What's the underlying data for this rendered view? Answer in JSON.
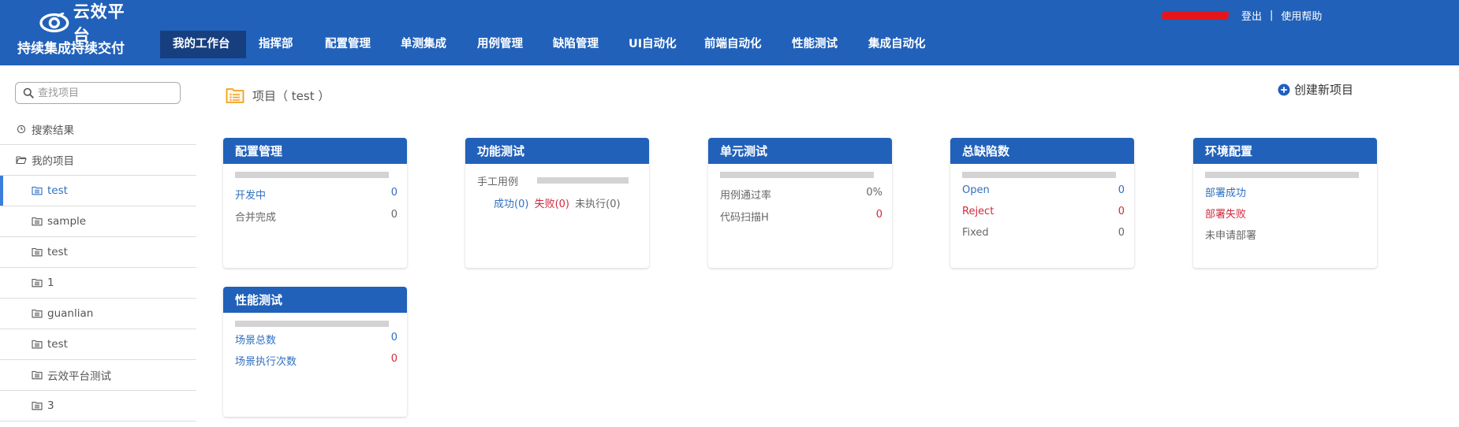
{
  "brand": {
    "name": "云效平台",
    "subtitle": "持续集成持续交付"
  },
  "nav": {
    "items": [
      {
        "label": "我的工作台",
        "active": true
      },
      {
        "label": "指挥部"
      },
      {
        "label": "配置管理"
      },
      {
        "label": "单测集成"
      },
      {
        "label": "用例管理"
      },
      {
        "label": "缺陷管理"
      },
      {
        "label": "UI自动化"
      },
      {
        "label": "前端自动化"
      },
      {
        "label": "性能测试"
      },
      {
        "label": "集成自动化"
      }
    ]
  },
  "user": {
    "logout": "登出",
    "separator": "|",
    "help": "使用帮助"
  },
  "sidebar": {
    "search_placeholder": "查找项目",
    "search_results": "搜索结果",
    "my_projects": "我的项目",
    "projects": [
      "test",
      "sample",
      "test",
      "1",
      "guanlian",
      "test",
      "云效平台测试",
      "3"
    ]
  },
  "page": {
    "title": "项目（ test ）",
    "create_label": "创建新项目"
  },
  "cards": {
    "config": {
      "title": "配置管理",
      "rows": [
        {
          "label": "开发中",
          "value": "0"
        },
        {
          "label": "合并完成",
          "value": "0"
        }
      ]
    },
    "func": {
      "title": "功能测试",
      "manual_label": "手工用例",
      "passed": "成功(0)",
      "failed": "失败(0)",
      "not_run": "未执行(0)"
    },
    "unit": {
      "title": "单元测试",
      "rows": [
        {
          "label": "用例通过率",
          "value": "0%"
        },
        {
          "label": "代码扫描H",
          "value": "0"
        }
      ]
    },
    "defects": {
      "title": "总缺陷数",
      "rows": [
        {
          "label": "Open",
          "value": "0"
        },
        {
          "label": "Reject",
          "value": "0"
        },
        {
          "label": "Fixed",
          "value": "0"
        }
      ]
    },
    "env": {
      "title": "环境配置",
      "rows": [
        {
          "label": "部署成功"
        },
        {
          "label": "部署失败"
        },
        {
          "label": "未申请部署"
        }
      ]
    },
    "perf": {
      "title": "性能测试",
      "rows": [
        {
          "label": "场景总数",
          "value": "0"
        },
        {
          "label": "场景执行次数",
          "value": "0"
        }
      ]
    }
  },
  "colors": {
    "header": "#2161b9",
    "nav_active": "#173f80",
    "link": "#2f6fc1",
    "danger": "#d0283c",
    "placeholder_bar": "#d3d3d3"
  },
  "icons": {
    "search": "search-icon",
    "history": "clock-icon",
    "folder": "folder-icon",
    "project": "project-icon",
    "list_folder": "list-folder-icon",
    "plus": "plus-circle-icon"
  }
}
